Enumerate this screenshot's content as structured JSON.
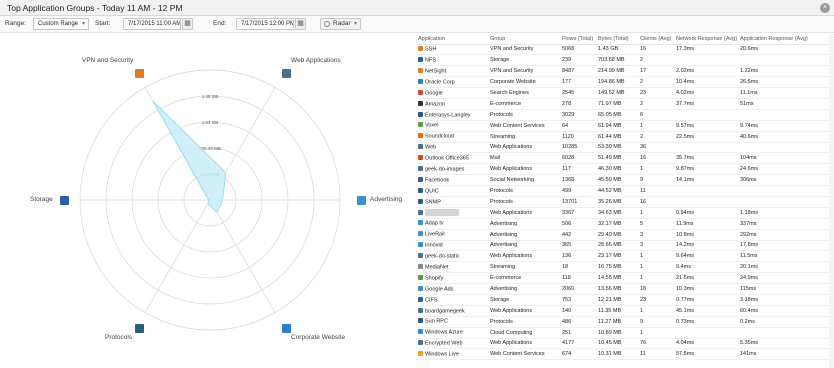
{
  "window": {
    "title": "Top Application Groups - Today 11 AM - 12 PM",
    "close_icon": "×"
  },
  "toolbar": {
    "range_label": "Range:",
    "range_value": "Custom Range",
    "start_label": "Start:",
    "start_value": "7/17/2015 11:00 AM",
    "end_label": "End:",
    "end_value": "7/17/2015 12:00 PM",
    "chart_type": "Radar"
  },
  "chart_data": {
    "type": "radar",
    "axes": [
      "VPN and Security",
      "Web Applications",
      "Advertising",
      "Corporate Website",
      "Protocols",
      "Storage"
    ],
    "ring_labels": [
      "1.48 GB",
      "1.04 GB",
      "625.45 MB",
      "10.74 MB"
    ],
    "values_gb": [
      1.63,
      0.45,
      0.18,
      0.2,
      0.06,
      0.02
    ],
    "rmax_gb": 1.85,
    "fill_color": "#c9ecf8",
    "stroke_color": "#8fd6ef"
  },
  "axis_icons": [
    {
      "name": "vpn-security-icon",
      "color": "#e07b1f"
    },
    {
      "name": "web-applications-icon",
      "color": "#4a6f8f"
    },
    {
      "name": "advertising-icon",
      "color": "#3a8fd0"
    },
    {
      "name": "corporate-website-icon",
      "color": "#2f7fc6"
    },
    {
      "name": "protocols-icon",
      "color": "#2b5d7a"
    },
    {
      "name": "storage-icon",
      "color": "#2c5fa8"
    }
  ],
  "table": {
    "columns": [
      "Application",
      "Group",
      "Flows (Total)",
      "Bytes (Total)",
      "Clients (Avg)",
      "Network Response (Avg)",
      "Application Response (Avg)"
    ],
    "rows": [
      [
        "SSH",
        "VPN and Security",
        "5068",
        "1.43 GB",
        "16",
        "17.3ms",
        "20.6ms"
      ],
      [
        "NFS",
        "Storage",
        "239",
        "703.68 MB",
        "2",
        "",
        ""
      ],
      [
        "NetSight",
        "VPN and Security",
        "8487",
        "214.99 MB",
        "17",
        "2.02ms",
        "1.22ms"
      ],
      [
        "Oracle Corp",
        "Corporate Website",
        "177",
        "194.86 MB",
        "2",
        "10.4ms",
        "26.5ms"
      ],
      [
        "Google",
        "Search Engines",
        "2545",
        "149.52 MB",
        "23",
        "4.02ms",
        "11.1ms"
      ],
      [
        "Amazon",
        "E-commerce",
        "278",
        "71.97 MB",
        "2",
        "37.7ms",
        "51ms"
      ],
      [
        "Enterasys-Langley",
        "Protocols",
        "3029",
        "65.05 MB",
        "6",
        "",
        ""
      ],
      [
        "Voxel",
        "Web Content Services",
        "64",
        "61.94 MB",
        "1",
        "9.57ms",
        "9.74ms"
      ],
      [
        "Soundcloud",
        "Streaming",
        "1120",
        "61.44 MB",
        "2",
        "22.5ms",
        "40.6ms"
      ],
      [
        "Web",
        "Web Applications",
        "10285",
        "53.30 MB",
        "36",
        "",
        ""
      ],
      [
        "Outlook Office365",
        "Mail",
        "6028",
        "51.49 MB",
        "16",
        "35.7ms",
        "104ms"
      ],
      [
        "geek-do-images",
        "Web Applications",
        "117",
        "46.30 MB",
        "1",
        "9.87ms",
        "24.6ms"
      ],
      [
        "Facebook",
        "Social Networking",
        "1368",
        "45.50 MB",
        "9",
        "14.1ms",
        "306ms"
      ],
      [
        "QUIC",
        "Protocols",
        "499",
        "44.52 MB",
        "11",
        "",
        ""
      ],
      [
        "SNMP",
        "Protocols",
        "13701",
        "35.26 MB",
        "16",
        "",
        ""
      ],
      [
        "",
        "Web Applications",
        "3367",
        "34.63 MB",
        "1",
        "0.94ms",
        "1.18ms"
      ],
      [
        "Adap.tv",
        "Advertising",
        "506",
        "32.17 MB",
        "5",
        "11.9ms",
        "337ms"
      ],
      [
        "LiveRail",
        "Advertising",
        "442",
        "29.49 MB",
        "3",
        "10.8ms",
        "292ms"
      ],
      [
        "Innovid",
        "Advertising",
        "365",
        "28.66 MB",
        "3",
        "14.2ms",
        "17.8ms"
      ],
      [
        "geek-do-static",
        "Web Applications",
        "136",
        "23.17 MB",
        "1",
        "9.64ms",
        "11.5ms"
      ],
      [
        "MediaNet",
        "Streaming",
        "18",
        "16.75 MB",
        "1",
        "9.4ms",
        "20.1ms"
      ],
      [
        "Shopify",
        "E-commerce",
        "118",
        "14.55 MB",
        "1",
        "21.5ms",
        "24.9ms"
      ],
      [
        "Google Ads",
        "Advertising",
        "2060",
        "13.56 MB",
        "18",
        "10.3ms",
        "115ms"
      ],
      [
        "CIFS",
        "Storage",
        "753",
        "12.21 MB",
        "23",
        "0.77ms",
        "3.18ms"
      ],
      [
        "boardgamegeek",
        "Web Applications",
        "140",
        "11.35 MB",
        "1",
        "45.1ms",
        "60.4ms"
      ],
      [
        "Sun RPC",
        "Protocols",
        "486",
        "11.27 MB",
        "9",
        "0.73ms",
        "0.2ms"
      ],
      [
        "Windows Azure",
        "Cloud Computing",
        "251",
        "10.89 MB",
        "1",
        "",
        ""
      ],
      [
        "Encrypted Web",
        "Web Applications",
        "4177",
        "10.45 MB",
        "76",
        "4.04ms",
        "5.35ms"
      ],
      [
        "Windows Live",
        "Web Content Services",
        "674",
        "10.31 MB",
        "11",
        "57.5ms",
        "141ms"
      ]
    ],
    "row_icon_colors": [
      "#e07b1f",
      "#2c5fa8",
      "#e07b1f",
      "#2f7fc6",
      "#d44a3a",
      "#333",
      "#2b5d7a",
      "#5a9c3f",
      "#f06a1c",
      "#4a6f8f",
      "#d9441f",
      "#4a6f8f",
      "#3b5998",
      "#2b5d7a",
      "#2b5d7a",
      "#4a6f8f",
      "#3a8fd0",
      "#3a8fd0",
      "#3a8fd0",
      "#4a6f8f",
      "#888",
      "#5b9c3b",
      "#3a8fd0",
      "#2c5fa8",
      "#4a6f8f",
      "#2b5d7a",
      "#2f8fd8",
      "#4a6f8f",
      "#f2a31a"
    ]
  }
}
